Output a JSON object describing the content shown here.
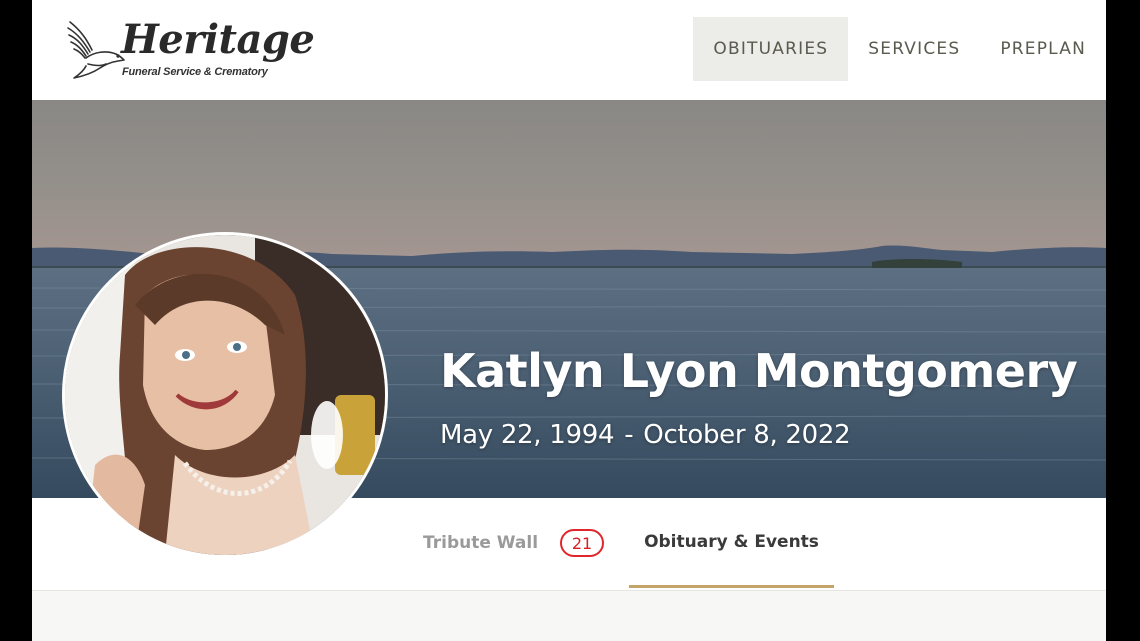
{
  "brand": {
    "name": "Heritage",
    "tagline": "Funeral Service & Crematory"
  },
  "nav": {
    "items": [
      {
        "label": "OBITUARIES",
        "active": true
      },
      {
        "label": "SERVICES",
        "active": false
      },
      {
        "label": "PREPLAN",
        "active": false
      }
    ]
  },
  "deceased": {
    "name": "Katlyn Lyon Montgomery",
    "birth": "May 22, 1994",
    "separator": "-",
    "death": "October 8, 2022"
  },
  "tabs": {
    "tribute_label": "Tribute Wall",
    "tribute_count": "21",
    "obituary_label": "Obituary & Events"
  },
  "colors": {
    "accent_underline": "#c5a46a",
    "badge_red": "#d81f26",
    "nav_active_bg": "#ecece9"
  }
}
